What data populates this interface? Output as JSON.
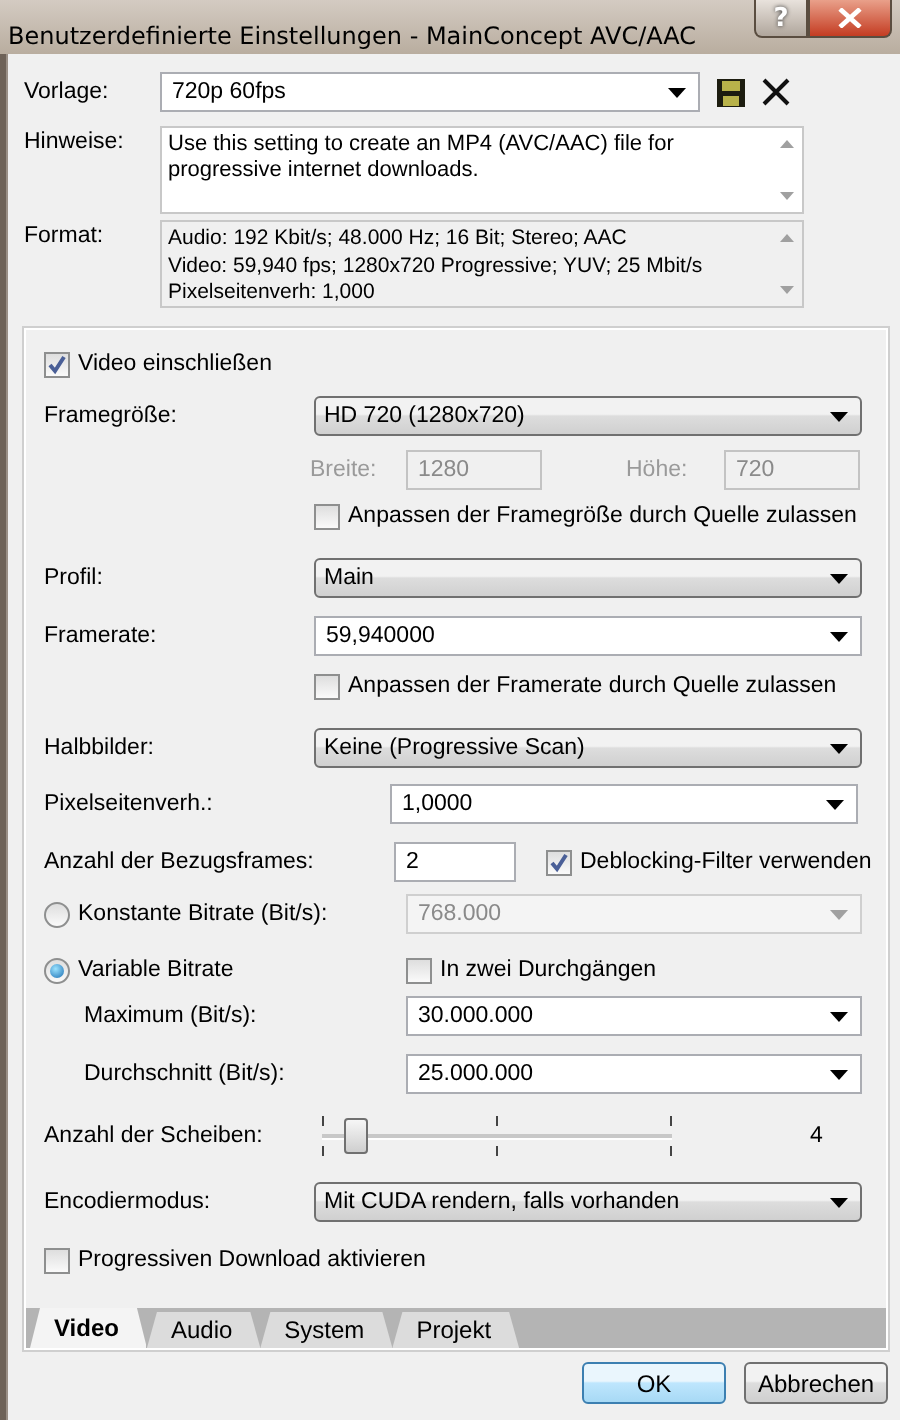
{
  "window": {
    "title": "Benutzerdefinierte Einstellungen - MainConcept AVC/AAC",
    "help": "?"
  },
  "preset": {
    "label": "Vorlage:",
    "value": "720p 60fps"
  },
  "notes": {
    "label": "Hinweise:",
    "lines": [
      "Use this setting to create an MP4 (AVC/AAC) file for",
      "progressive internet downloads."
    ]
  },
  "format": {
    "label": "Format:",
    "lines": [
      "Audio: 192 Kbit/s; 48.000 Hz; 16 Bit; Stereo; AAC",
      "Video: 59,940 fps; 1280x720 Progressive; YUV; 25 Mbit/s",
      "Pixelseitenverh: 1,000"
    ]
  },
  "video": {
    "include": {
      "label": "Video einschließen",
      "checked": true
    },
    "frame_size": {
      "label": "Framegröße:",
      "value": "HD 720 (1280x720)"
    },
    "width": {
      "label": "Breite:",
      "value": "1280",
      "disabled": true
    },
    "height": {
      "label": "Höhe:",
      "value": "720",
      "disabled": true
    },
    "frame_size_from_source": {
      "label": "Anpassen der Framegröße durch Quelle zulassen",
      "checked": false
    },
    "profile": {
      "label": "Profil:",
      "value": "Main"
    },
    "framerate": {
      "label": "Framerate:",
      "value": "59,940000"
    },
    "framerate_from_source": {
      "label": "Anpassen der Framerate durch Quelle zulassen",
      "checked": false
    },
    "fields": {
      "label": "Halbbilder:",
      "value": "Keine (Progressive Scan)"
    },
    "pixel_aspect": {
      "label": "Pixelseitenverh.:",
      "value": "1,0000"
    },
    "ref_frames": {
      "label": "Anzahl der Bezugsframes:",
      "value": "2"
    },
    "deblocking": {
      "label": "Deblocking-Filter verwenden",
      "checked": true
    },
    "bitrate_modes": [
      {
        "label": "Konstante Bitrate (Bit/s):",
        "selected": false,
        "value": "768.000"
      },
      {
        "label": "Variable Bitrate",
        "selected": true
      }
    ],
    "two_pass": {
      "label": "In zwei Durchgängen",
      "checked": false
    },
    "maximum": {
      "label": "Maximum (Bit/s):",
      "value": "30.000.000"
    },
    "average": {
      "label": "Durchschnitt (Bit/s):",
      "value": "25.000.000"
    },
    "slices": {
      "label": "Anzahl der Scheiben:",
      "level": 0.07,
      "reading": "4"
    },
    "encode_mode": {
      "label": "Encodiermodus:",
      "value": "Mit CUDA rendern, falls vorhanden"
    },
    "progressive_download": {
      "label": "Progressiven Download aktivieren",
      "checked": false
    }
  },
  "tabs": [
    {
      "label": "Video",
      "selected": true
    },
    {
      "label": "Audio",
      "selected": false
    },
    {
      "label": "System",
      "selected": false
    },
    {
      "label": "Projekt",
      "selected": false
    }
  ],
  "buttons": [
    {
      "label": "OK",
      "default": true
    },
    {
      "label": "Abbrechen",
      "default": false
    }
  ]
}
